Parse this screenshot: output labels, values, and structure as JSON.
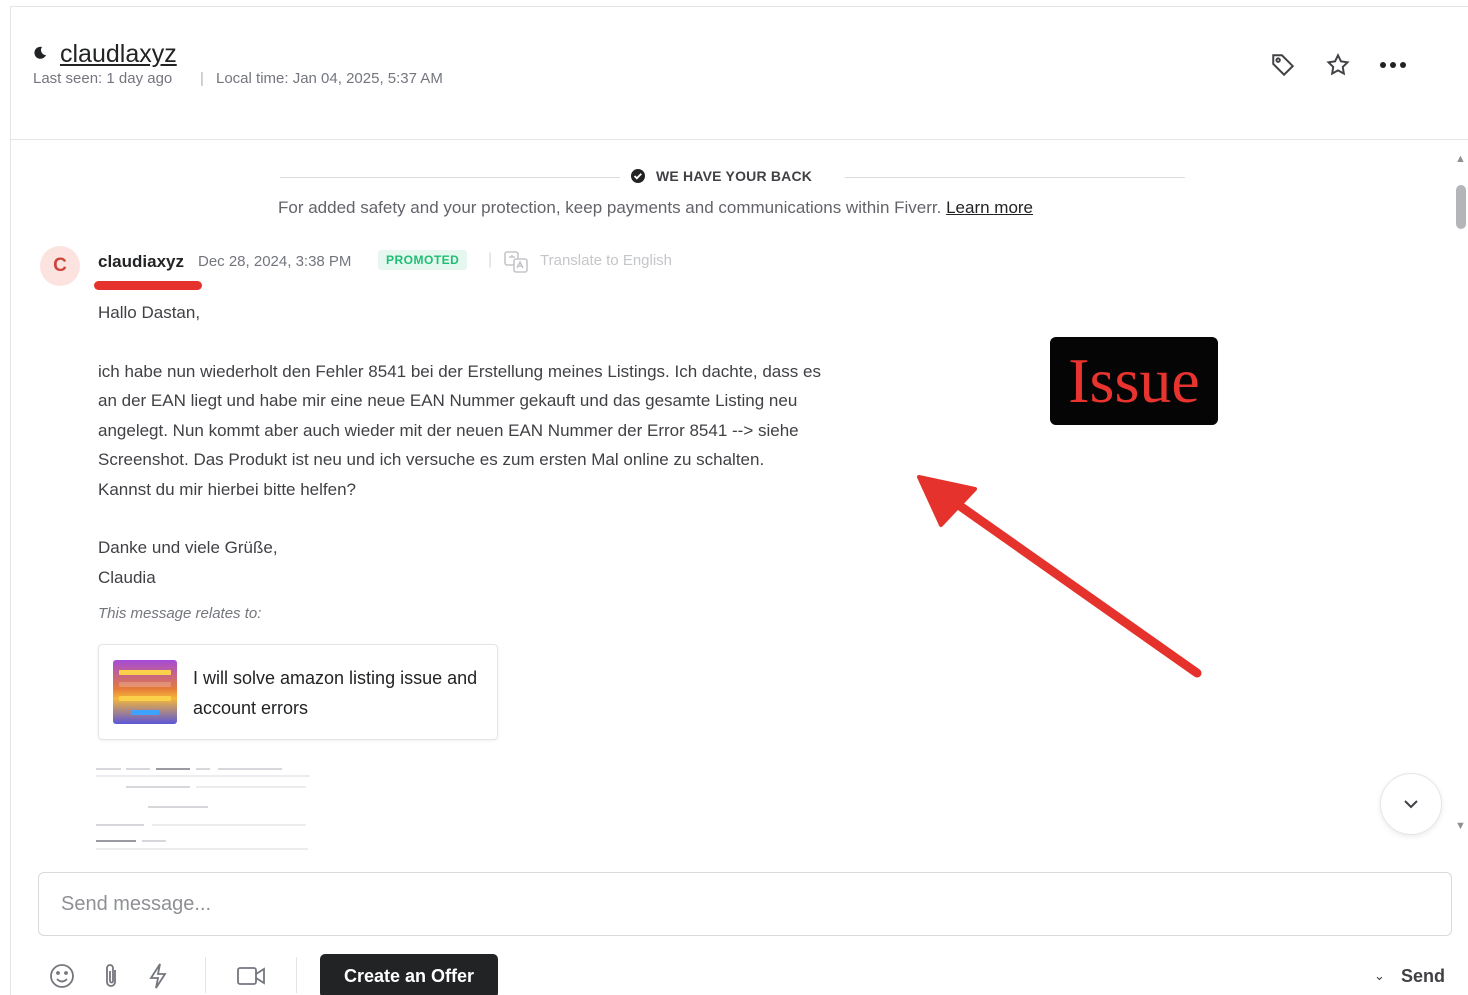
{
  "header": {
    "username": "claudlaxyz",
    "last_seen": "Last seen: 1 day ago",
    "separator": "|",
    "local_time": "Local time: Jan 04, 2025, 5:37 AM",
    "icons": [
      "tag-icon",
      "star-icon",
      "more-icon"
    ]
  },
  "safety_banner": {
    "title": "WE HAVE YOUR BACK",
    "text": "For added safety and your protection, keep payments and communications within Fiverr.",
    "link": "Learn more"
  },
  "message": {
    "avatar_initial": "C",
    "author": "claudiaxyz",
    "timestamp": "Dec 28, 2024, 3:38 PM",
    "badge": "PROMOTED",
    "separator": "|",
    "translate_label": "Translate to English",
    "greeting": "Hallo Dastan,",
    "paragraph_lines": [
      "ich habe nun wiederholt den Fehler 8541 bei der Erstellung meines Listings. Ich dachte, dass es",
      "an der EAN liegt und habe mir eine neue EAN Nummer gekauft und das gesamte Listing neu",
      "angelegt. Nun kommt aber auch wieder mit der neuen EAN Nummer der Error 8541 --> siehe",
      "Screenshot. Das Produkt ist neu und ich versuche es zum ersten Mal  online zu schalten.",
      "Kannst du mir hierbei bitte helfen?"
    ],
    "closing": "Danke und viele Grüße,",
    "signature": "Claudia",
    "relates_label": "This message relates to:",
    "gig_title": "I will solve amazon listing issue and account errors"
  },
  "annotation": {
    "label": "Issue",
    "label_color": "#e8332e",
    "arrow_color": "#e5322d"
  },
  "composer": {
    "placeholder": "Send message...",
    "offer_button": "Create an Offer",
    "send_label": "Send",
    "tools": [
      "emoji-icon",
      "paperclip-icon",
      "lightning-icon",
      "video-icon"
    ]
  },
  "colors": {
    "accent_green": "#1dbf73",
    "text_dark": "#222325",
    "button_dark": "#222325"
  }
}
